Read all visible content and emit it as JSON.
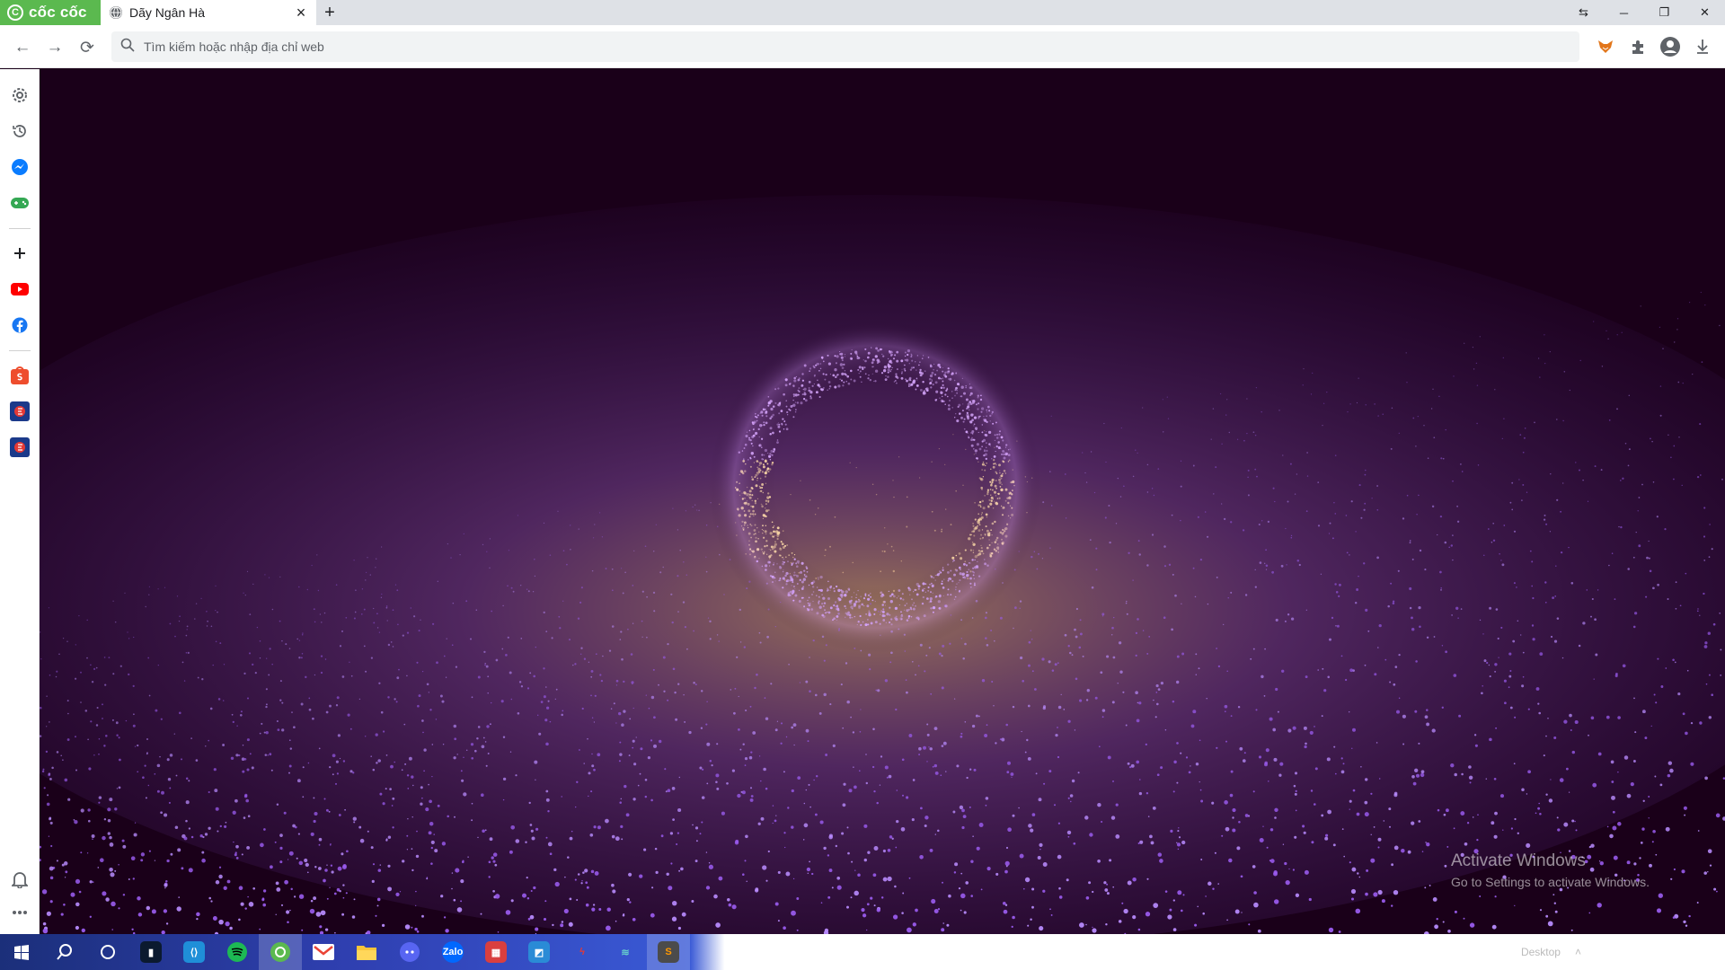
{
  "browser": {
    "brand": "cốc cốc",
    "tab": {
      "title": "Dãy Ngân Hà"
    },
    "omnibox": {
      "placeholder": "Tìm kiếm hoặc nhập địa chỉ web"
    }
  },
  "icons": {
    "back": "arrow-left-icon",
    "forward": "arrow-right-icon",
    "reload": "reload-icon",
    "search": "search-icon",
    "extensions": [
      "fox-extension-icon",
      "puzzle-icon",
      "account-icon",
      "download-icon"
    ]
  },
  "sidebar": {
    "items": [
      "settings-icon",
      "history-icon",
      "messenger-icon",
      "gamepad-icon",
      "add-icon",
      "youtube-icon",
      "facebook-icon",
      "shopee-icon",
      "game-app-icon",
      "game-app-icon"
    ],
    "bottom": [
      "bell-icon",
      "more-icon"
    ]
  },
  "page": {
    "watermark_title": "Activate Windows",
    "watermark_sub": "Go to Settings to activate Windows.",
    "colors": {
      "background": "#1a0019",
      "particle_violet": "#9b5cf0",
      "particle_core": "#ffd49a"
    }
  },
  "taskbar": {
    "apps": [
      "windows-start-icon",
      "search-icon",
      "cortana-icon",
      "app-icon",
      "vscode-icon",
      "spotify-icon",
      "coccoc-icon",
      "gmail-icon",
      "file-explorer-icon",
      "discord-icon",
      "zalo-icon",
      "app-icon",
      "app-icon",
      "app-icon",
      "app-icon",
      "sublime-icon"
    ],
    "zalo_label": "Zalo",
    "tray_label": "Desktop"
  }
}
